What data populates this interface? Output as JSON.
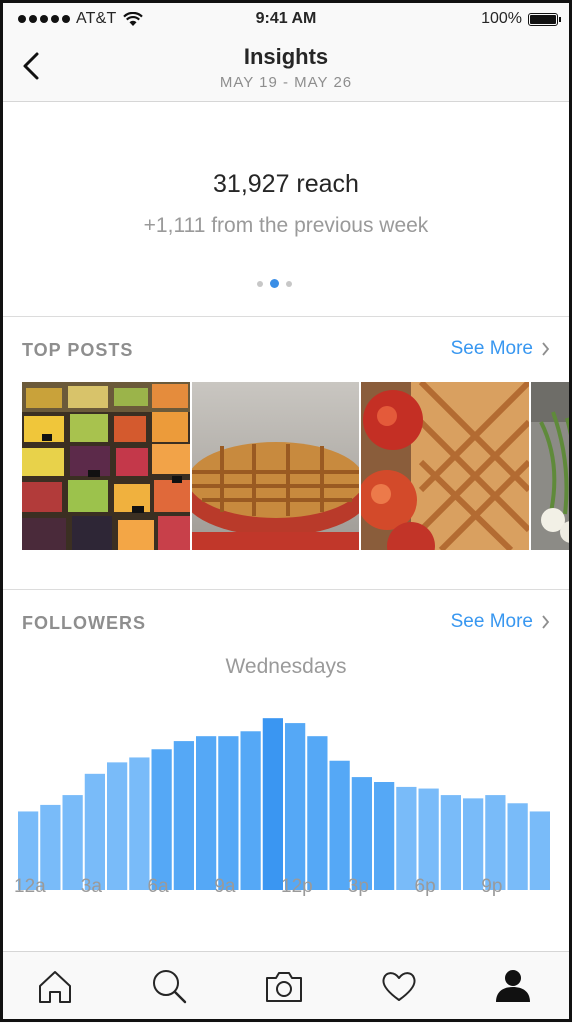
{
  "status_bar": {
    "carrier": "AT&T",
    "time": "9:41 AM",
    "battery": "100%"
  },
  "header": {
    "title": "Insights",
    "date_range": "MAY 19 - MAY 26"
  },
  "summary": {
    "reach": "31,927 reach",
    "change": "+1,111 from the previous week",
    "page_index": 2,
    "page_count": 3
  },
  "top_posts": {
    "title": "TOP POSTS",
    "see_more": "See More",
    "posts": [
      {
        "subject": "market-produce-photo"
      },
      {
        "subject": "pie-photo"
      },
      {
        "subject": "apple-pie-photo"
      },
      {
        "subject": "green-onions-photo"
      }
    ]
  },
  "followers": {
    "title": "FOLLOWERS",
    "see_more": "See More",
    "day": "Wednesdays"
  },
  "chart_data": {
    "type": "bar",
    "title": "Wednesdays",
    "categories": [
      "12a",
      "1a",
      "2a",
      "3a",
      "4a",
      "5a",
      "6a",
      "7a",
      "8a",
      "9a",
      "10a",
      "11a",
      "12p",
      "1p",
      "2p",
      "3p",
      "4p",
      "5p",
      "6p",
      "7p",
      "8p",
      "9p",
      "10p",
      "11p"
    ],
    "tick_labels": [
      "12a",
      "3a",
      "6a",
      "9a",
      "12p",
      "3p",
      "6p",
      "9p"
    ],
    "values": [
      48,
      52,
      58,
      71,
      78,
      81,
      86,
      91,
      94,
      94,
      97,
      105,
      102,
      94,
      79,
      69,
      66,
      63,
      62,
      58,
      56,
      58,
      53,
      48
    ],
    "ylim": [
      0,
      110
    ],
    "highlight_index": 11,
    "colors": {
      "base": "#79bbf9",
      "strong": "#3a96f2"
    }
  },
  "tab_bar": {
    "tabs": [
      {
        "icon": "home-icon"
      },
      {
        "icon": "search-icon"
      },
      {
        "icon": "camera-icon"
      },
      {
        "icon": "heart-icon"
      },
      {
        "icon": "profile-icon"
      }
    ]
  }
}
